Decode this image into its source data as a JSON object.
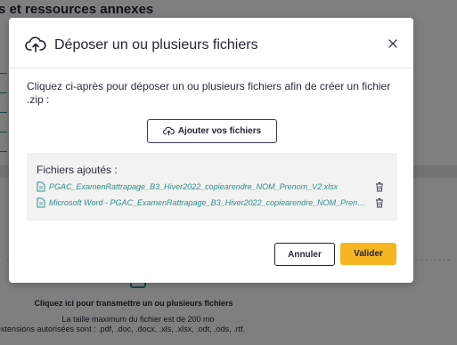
{
  "background": {
    "heading": "s et ressources annexes",
    "link_marks": [
      "c",
      "c",
      "c",
      "c",
      "c"
    ],
    "dropzone": {
      "title": "Cliquez ici pour transmettre un ou plusieurs fichiers",
      "max_size": "La taille maximum du fichier est de 200 mo",
      "extensions": "extensions autorisées sont : .pdf, .doc, .docx, .xls, .xlsx, .odt, .ods, .rtf."
    }
  },
  "modal": {
    "title": "Déposer un ou plusieurs fichiers",
    "intro": "Cliquez ci-après pour déposer un ou plusieurs fichiers afin de créer un fichier .zip :",
    "add_button_label": "Ajouter vos fichiers",
    "files_label": "Fichiers ajoutés :",
    "files": [
      "PGAC_ExamenRattrapage_B3_Hiver2022_copiearendre_NOM_Prenom_V2.xlsx",
      "Microsoft Word - PGAC_ExamenRattrapage_B3_Hiver2022_copiearendre_NOM_Prenom.pdf"
    ],
    "cancel_label": "Annuler",
    "validate_label": "Valider"
  },
  "colors": {
    "accent": "#f7b521",
    "link": "#2f8d8d",
    "text": "#1f2430"
  },
  "icons": {
    "header": "upload-cloud-icon",
    "close": "close-icon",
    "add": "upload-cloud-icon",
    "file": "file-icon",
    "delete": "trash-icon"
  }
}
